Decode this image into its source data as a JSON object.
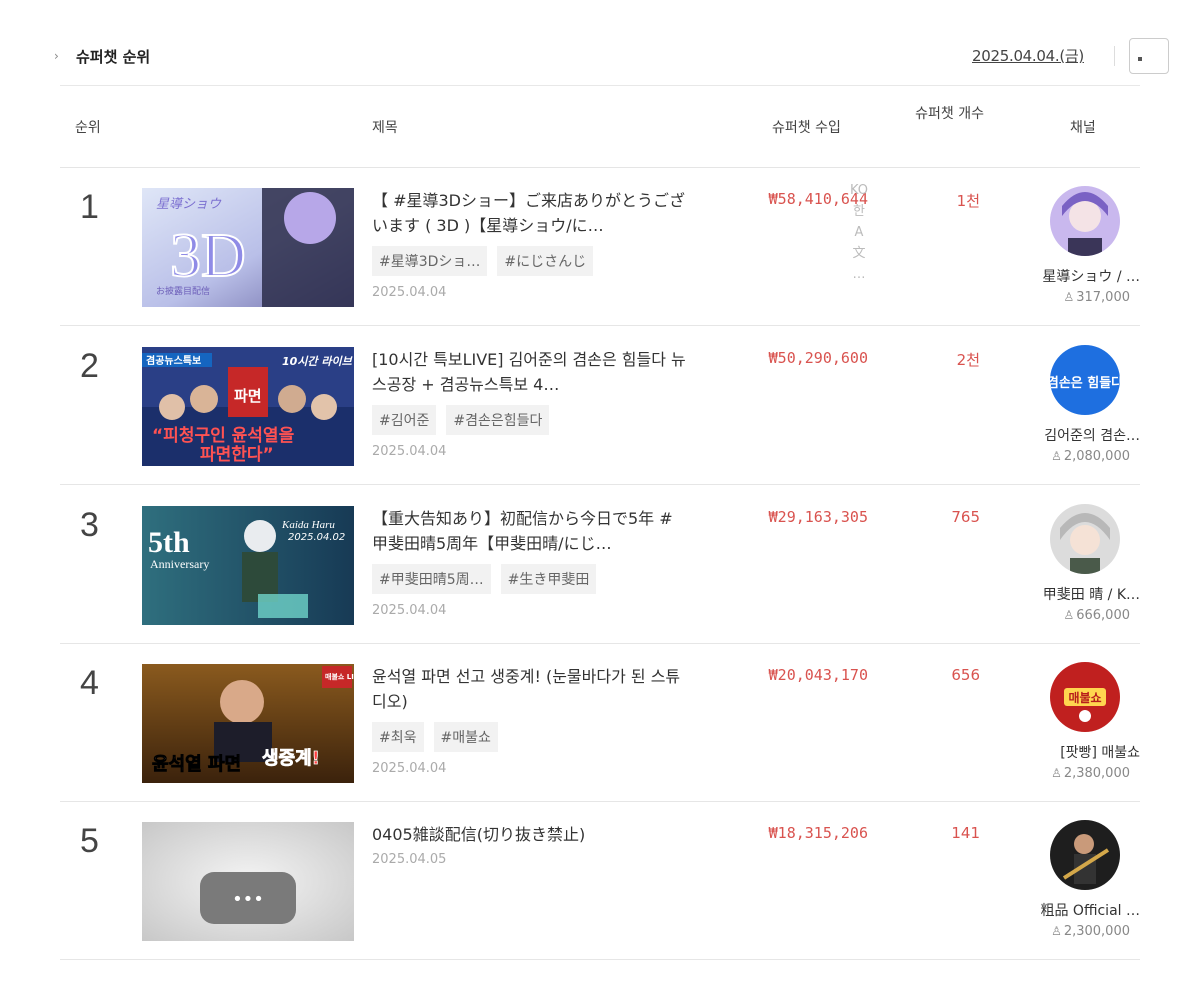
{
  "header": {
    "chevron": "›",
    "title": "슈퍼챗 순위",
    "date": "2025.04.04.(금)"
  },
  "columns": {
    "rank": "순위",
    "title": "제목",
    "revenue": "슈퍼챗 수입",
    "count": "슈퍼챗 개수",
    "channel": "채널"
  },
  "side_ad": [
    "KO",
    "한",
    "A",
    "文",
    "…"
  ],
  "rows": [
    {
      "rank": "1",
      "title": "【 #星導3Dショー】ご来店ありがとうございます ( 3D )【星導ショウ/に…",
      "tags": [
        "#星導3Dショ…",
        "#にじさんじ"
      ],
      "date": "2025.04.04",
      "revenue": "₩58,410,644",
      "count": "1천",
      "channel": "星導ショウ / …",
      "subscribers": "317,000",
      "thumb_text": [
        "星導ショウ",
        "3D",
        "お披露目配信"
      ]
    },
    {
      "rank": "2",
      "title": "[10시간 특보LIVE] 김어준의 겸손은 힘들다 뉴스공장 + 겸공뉴스특보 4…",
      "tags": [
        "#김어준",
        "#겸손은힘들다"
      ],
      "date": "2025.04.04",
      "revenue": "₩50,290,600",
      "count": "2천",
      "channel": "김어준의 겸손…",
      "subscribers": "2,080,000",
      "thumb_text": [
        "겸공뉴스특보",
        "10시간 라이브",
        "파면",
        "“피청구인 윤석열을",
        "파면한다”"
      ]
    },
    {
      "rank": "3",
      "title": "【重大告知あり】初配信から今日で5年 #甲斐田晴5周年【甲斐田晴/にじ…",
      "tags": [
        "#甲斐田晴5周…",
        "#生き甲斐田"
      ],
      "date": "2025.04.04",
      "revenue": "₩29,163,305",
      "count": "765",
      "channel": "甲斐田 晴 / K…",
      "subscribers": "666,000",
      "thumb_text": [
        "5th",
        "Anniversary",
        "Kaida Haru",
        "2025.04.02"
      ]
    },
    {
      "rank": "4",
      "title": "윤석열 파면 선고 생중계! (눈물바다가 된 스튜디오)",
      "tags": [
        "#최욱",
        "#매불쇼"
      ],
      "date": "2025.04.04",
      "revenue": "₩20,043,170",
      "count": "656",
      "channel": "[팟빵] 매불쇼",
      "subscribers": "2,380,000",
      "thumb_text": [
        "매불쇼 LIVE",
        "윤석열 파면",
        "생중계!"
      ]
    },
    {
      "rank": "5",
      "title": "0405雑談配信(切り抜き禁止)",
      "tags": [],
      "date": "2025.04.05",
      "revenue": "₩18,315,206",
      "count": "141",
      "channel": "粗品 Official …",
      "subscribers": "2,300,000",
      "thumb_text": [
        "•••"
      ]
    }
  ],
  "avatars": [
    "매불쇼",
    "겸손은 힘들다"
  ],
  "colors": {
    "revenue": "#d9534f",
    "divider": "#e6e6e6"
  }
}
